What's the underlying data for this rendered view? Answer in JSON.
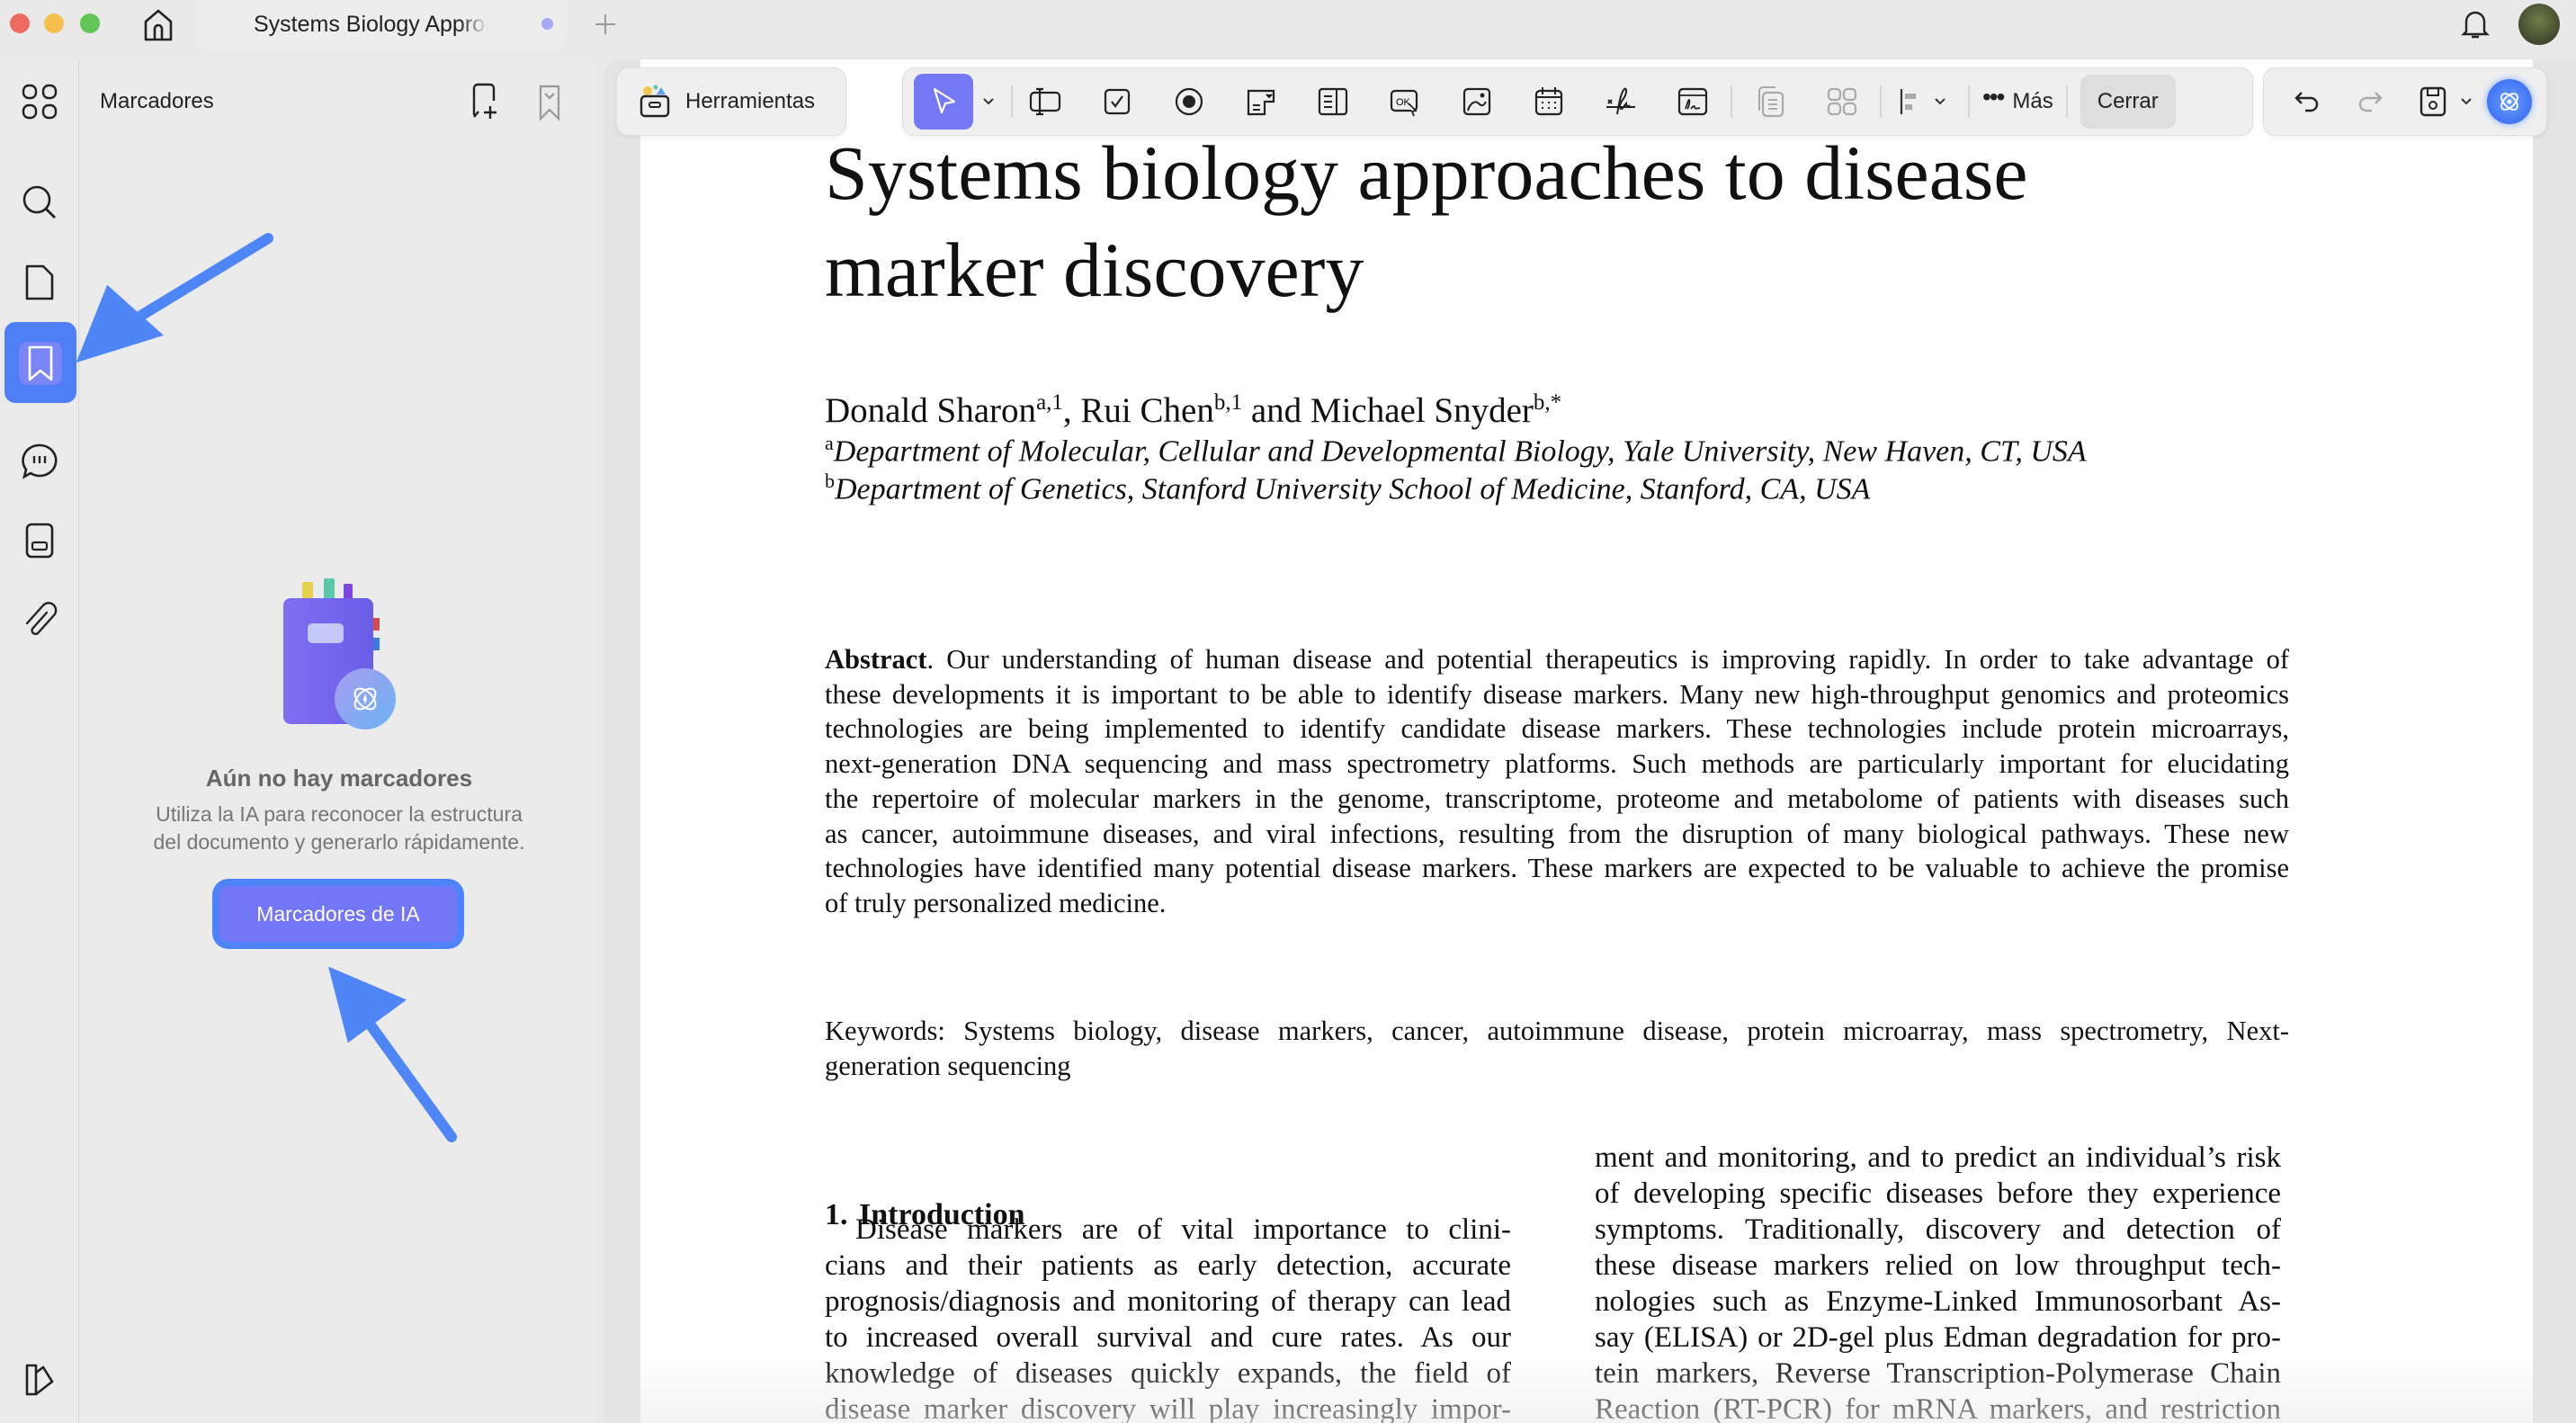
{
  "window": {
    "tab_title": "Systems Biology Approaches to Disease Marker Discovery",
    "tab_dot_color": "#a5a8f5"
  },
  "toolbar": {
    "tools_label": "Herramientas",
    "more_label": "Más",
    "close_label": "Cerrar",
    "accent": "#7478f5"
  },
  "panel": {
    "title": "Marcadores",
    "empty_title": "Aún no hay marcadores",
    "empty_desc_1": "Utiliza la IA para reconocer la estructura",
    "empty_desc_2": "del documento y generarlo rápidamente.",
    "ai_button": "Marcadores de IA"
  },
  "document": {
    "title_1": "Systems biology approaches to disease",
    "title_2": "marker discovery",
    "authors": [
      {
        "name": "Donald Sharon",
        "sup": "a,1"
      },
      {
        "name": ", Rui Chen",
        "sup": "b,1"
      },
      {
        "name": " and Michael Snyder",
        "sup": "b,*"
      }
    ],
    "affil_a_sup": "a",
    "affil_a": "Department of Molecular, Cellular and Developmental Biology, Yale University, New Haven, CT, USA",
    "affil_b_sup": "b",
    "affil_b": "Department of Genetics, Stanford University School of Medicine, Stanford, CA, USA",
    "abstract_label": "Abstract",
    "abstract_lines": [
      ". Our understanding of human disease and potential therapeutics is improving rapidly.  In order to take advantage of",
      "these developments it is important to be able to identify disease markers. Many new high-throughput genomics and proteomics",
      "technologies are being implemented to identify candidate disease markers.  These technologies include protein microarrays,",
      "next-generation DNA sequencing and mass spectrometry platforms.  Such methods are particularly important for elucidating",
      "the repertoire of molecular markers in the genome, transcriptome, proteome and metabolome of patients with diseases such",
      "as cancer, autoimmune diseases, and viral infections, resulting from the disruption of many biological pathways.  These new",
      "technologies have identified many potential disease markers. These markers are expected to be valuable to achieve the promise",
      "of truly personalized medicine."
    ],
    "keywords_lines": [
      "Keywords: Systems biology, disease markers, cancer, autoimmune disease, protein microarray, mass spectrometry, Next-",
      "generation sequencing"
    ],
    "section_heading": "1.  Introduction",
    "left_col": [
      "Disease markers are of vital importance to clini-",
      "cians and their patients as early detection, accurate",
      "prognosis/diagnosis and monitoring of therapy can lead",
      "to increased overall survival and cure rates.  As our",
      "knowledge of diseases quickly expands, the field of",
      "disease marker discovery will play increasingly impor-"
    ],
    "right_col": [
      "ment and monitoring, and to predict an individual’s risk",
      "of developing specific diseases before they experience",
      "symptoms.  Traditionally, discovery and detection of",
      "these disease markers relied on low throughput tech-",
      "nologies such as Enzyme-Linked Immunosorbant As-",
      "say (ELISA) or 2D-gel plus Edman degradation for pro-",
      "tein markers, Reverse Transcription-Polymerase Chain",
      "Reaction (RT-PCR) for mRNA markers, and restriction"
    ]
  }
}
